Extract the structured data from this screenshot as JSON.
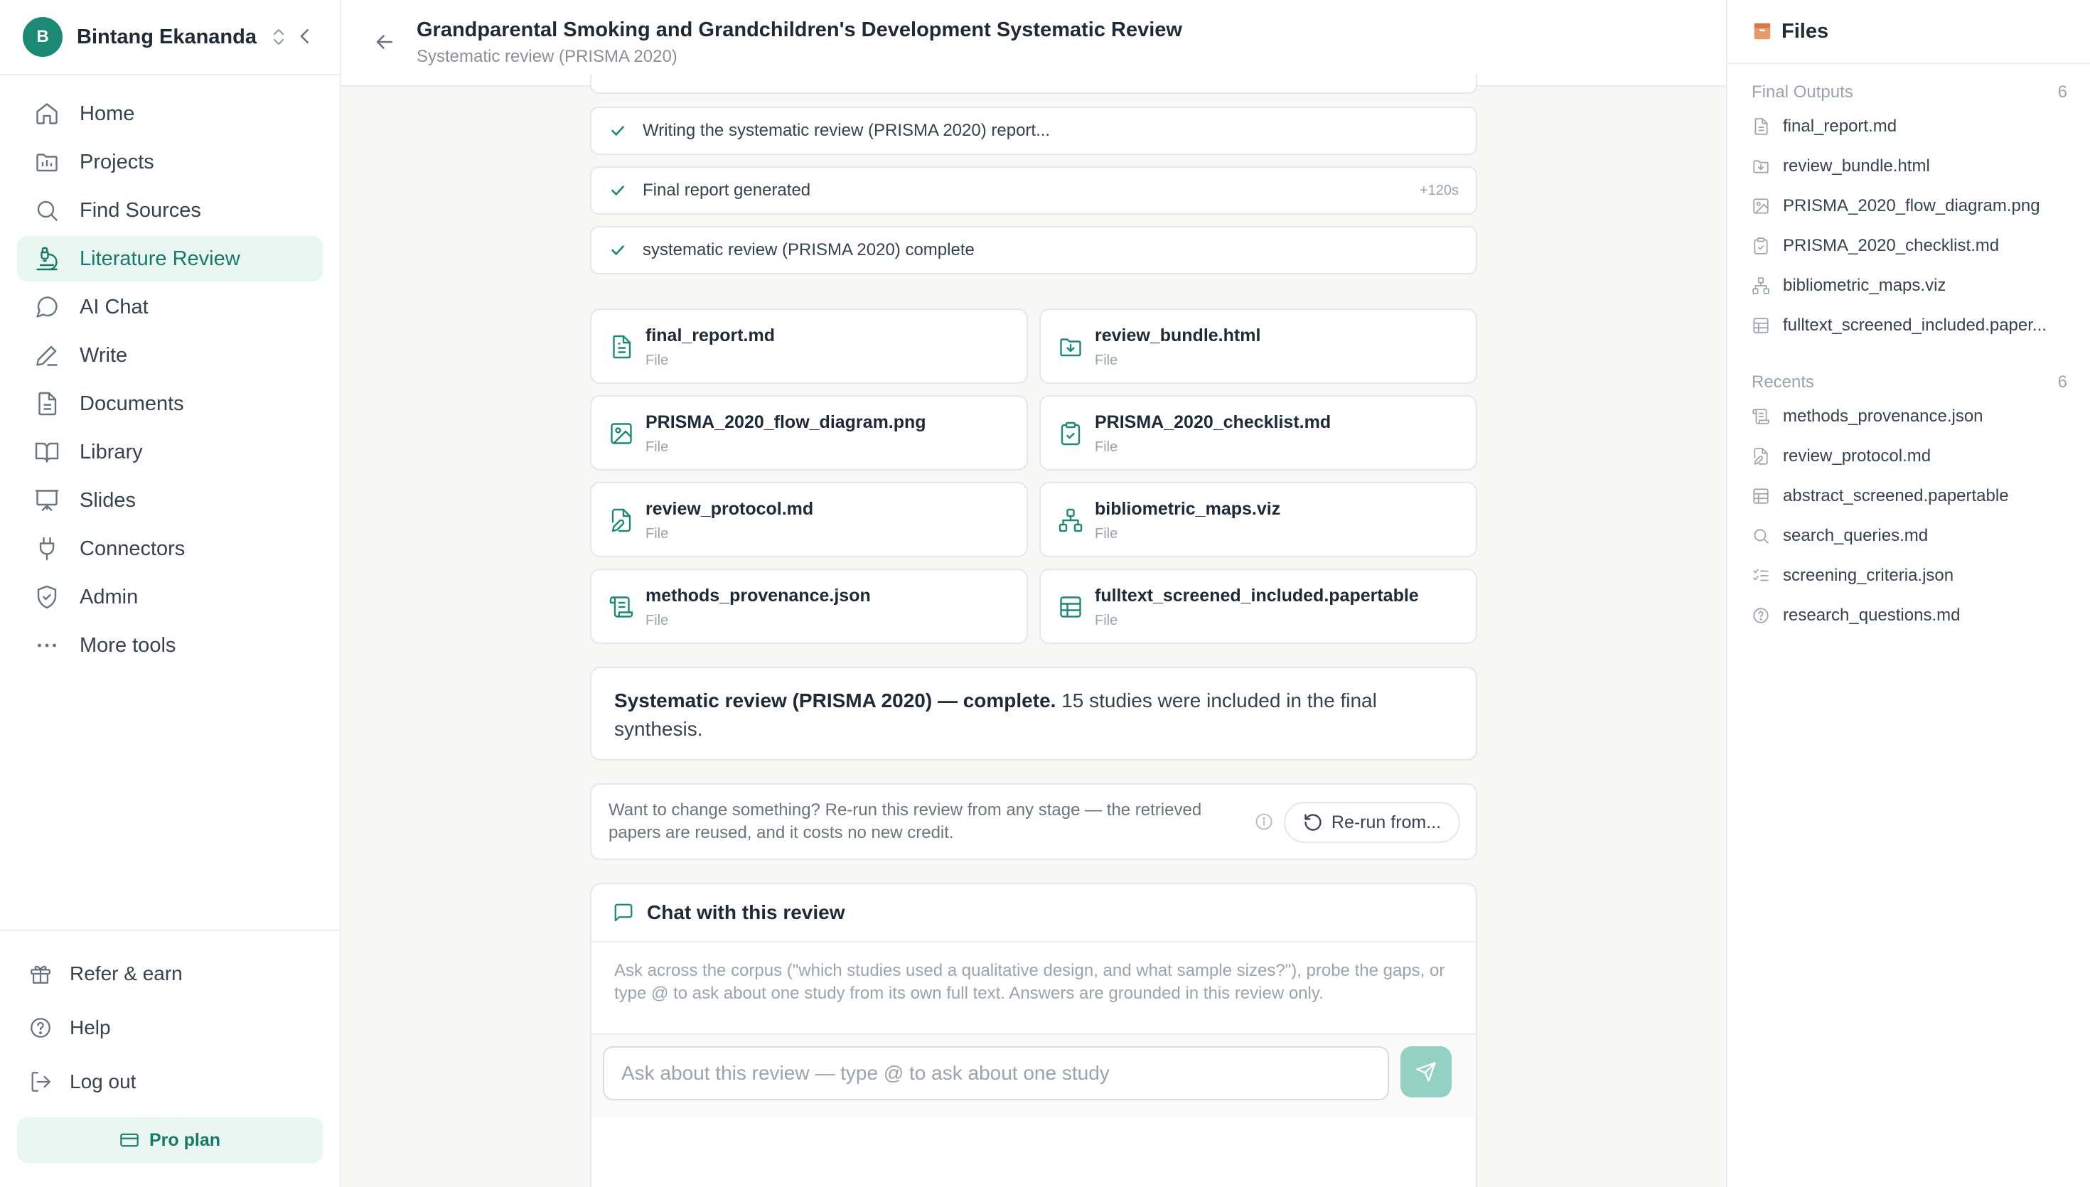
{
  "user": {
    "initial": "B",
    "name": "Bintang Ekananda"
  },
  "nav": [
    {
      "label": "Home",
      "icon": "home-icon"
    },
    {
      "label": "Projects",
      "icon": "projects-icon"
    },
    {
      "label": "Find Sources",
      "icon": "search-icon"
    },
    {
      "label": "Literature Review",
      "icon": "microscope-icon",
      "active": true
    },
    {
      "label": "AI Chat",
      "icon": "chat-icon"
    },
    {
      "label": "Write",
      "icon": "pen-icon"
    },
    {
      "label": "Documents",
      "icon": "document-icon"
    },
    {
      "label": "Library",
      "icon": "book-icon"
    },
    {
      "label": "Slides",
      "icon": "presentation-icon"
    },
    {
      "label": "Connectors",
      "icon": "plug-icon"
    },
    {
      "label": "Admin",
      "icon": "shield-icon"
    },
    {
      "label": "More tools",
      "icon": "more-icon"
    }
  ],
  "bottom_nav": [
    {
      "label": "Refer & earn",
      "icon": "gift-icon"
    },
    {
      "label": "Help",
      "icon": "help-icon"
    },
    {
      "label": "Log out",
      "icon": "logout-icon"
    }
  ],
  "plan_label": "Pro plan",
  "header": {
    "title": "Grandparental Smoking and Grandchildren's Development Systematic Review",
    "subtitle": "Systematic review (PRISMA 2020)"
  },
  "status_steps": [
    {
      "text": "Writing the systematic review (PRISMA 2020) report...",
      "time": ""
    },
    {
      "text": "Final report generated",
      "time": "+120s"
    },
    {
      "text": "systematic review (PRISMA 2020) complete",
      "time": ""
    }
  ],
  "file_cards": [
    {
      "name": "final_report.md",
      "type": "File",
      "icon": "file-text-icon"
    },
    {
      "name": "review_bundle.html",
      "type": "File",
      "icon": "folder-download-icon"
    },
    {
      "name": "PRISMA_2020_flow_diagram.png",
      "type": "File",
      "icon": "image-icon"
    },
    {
      "name": "PRISMA_2020_checklist.md",
      "type": "File",
      "icon": "clipboard-check-icon"
    },
    {
      "name": "review_protocol.md",
      "type": "File",
      "icon": "file-edit-icon"
    },
    {
      "name": "bibliometric_maps.viz",
      "type": "File",
      "icon": "network-icon"
    },
    {
      "name": "methods_provenance.json",
      "type": "File",
      "icon": "scroll-icon"
    },
    {
      "name": "fulltext_screened_included.papertable",
      "type": "File",
      "icon": "table-icon"
    }
  ],
  "summary": {
    "bold": "Systematic review (PRISMA 2020) — complete.",
    "rest": " 15 studies were included in the final synthesis."
  },
  "rerun": {
    "text": "Want to change something? Re-run this review from any stage — the retrieved papers are reused, and it costs no new credit.",
    "button": "Re-run from..."
  },
  "chat": {
    "title": "Chat with this review",
    "help": "Ask across the corpus (\"which studies used a qualitative design, and what sample sizes?\"), probe the gaps, or type @ to ask about one study from its own full text. Answers are grounded in this review only.",
    "placeholder": "Ask about this review — type @ to ask about one study"
  },
  "files_panel": {
    "title": "Files",
    "final_outputs": {
      "label": "Final Outputs",
      "count": "6",
      "items": [
        {
          "name": "final_report.md",
          "icon": "file-text-icon"
        },
        {
          "name": "review_bundle.html",
          "icon": "folder-download-icon"
        },
        {
          "name": "PRISMA_2020_flow_diagram.png",
          "icon": "image-icon"
        },
        {
          "name": "PRISMA_2020_checklist.md",
          "icon": "clipboard-check-icon"
        },
        {
          "name": "bibliometric_maps.viz",
          "icon": "network-icon"
        },
        {
          "name": "fulltext_screened_included.paper...",
          "icon": "table-icon"
        }
      ]
    },
    "recents": {
      "label": "Recents",
      "count": "6",
      "items": [
        {
          "name": "methods_provenance.json",
          "icon": "scroll-icon"
        },
        {
          "name": "review_protocol.md",
          "icon": "file-edit-icon"
        },
        {
          "name": "abstract_screened.papertable",
          "icon": "table-icon"
        },
        {
          "name": "search_queries.md",
          "icon": "search-icon"
        },
        {
          "name": "screening_criteria.json",
          "icon": "list-check-icon"
        },
        {
          "name": "research_questions.md",
          "icon": "help-icon"
        }
      ]
    }
  },
  "colors": {
    "accent": "#1a8a74",
    "accent_bg": "#eaf6f2",
    "send_disabled": "#93d1c2"
  }
}
